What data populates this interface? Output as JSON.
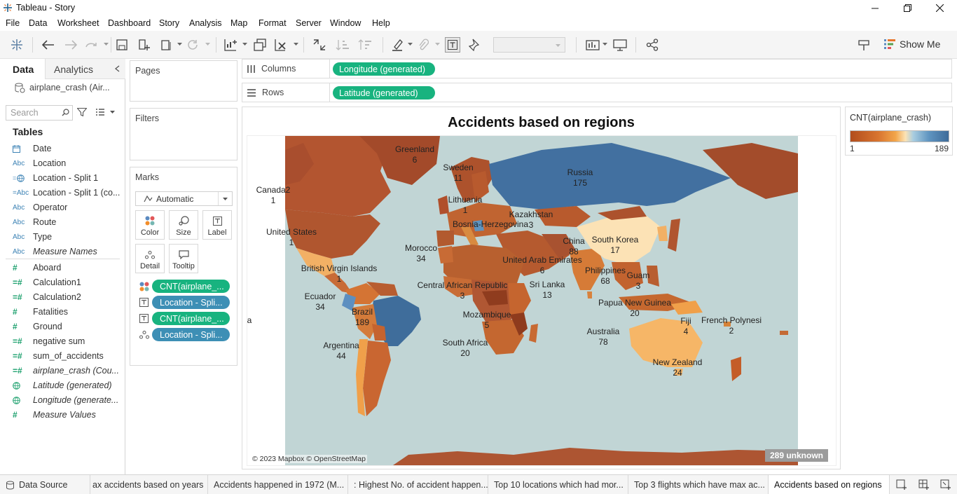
{
  "window": {
    "title": "Tableau - Story"
  },
  "menu": [
    "File",
    "Data",
    "Worksheet",
    "Dashboard",
    "Story",
    "Analysis",
    "Map",
    "Format",
    "Server",
    "Window",
    "Help"
  ],
  "toolbar": {
    "show_me": "Show Me"
  },
  "data_pane": {
    "tab_data": "Data",
    "tab_analytics": "Analytics",
    "datasource": "airplane_crash (Air...",
    "search_placeholder": "Search",
    "tables_header": "Tables",
    "fields": [
      {
        "icon": "calendar",
        "label": "Date",
        "italic": false
      },
      {
        "icon": "Abc",
        "label": "Location",
        "italic": false
      },
      {
        "icon": "globe",
        "label": "Location - Split 1",
        "italic": false
      },
      {
        "icon": "=Abc",
        "label": "Location - Split 1 (co...",
        "italic": false
      },
      {
        "icon": "Abc",
        "label": "Operator",
        "italic": false
      },
      {
        "icon": "Abc",
        "label": "Route",
        "italic": false
      },
      {
        "icon": "Abc",
        "label": "Type",
        "italic": false
      },
      {
        "icon": "Abc",
        "label": "Measure Names",
        "italic": true
      },
      {
        "icon": "#",
        "label": "Aboard",
        "italic": false
      },
      {
        "icon": "=#",
        "label": "Calculation1",
        "italic": false
      },
      {
        "icon": "=#",
        "label": "Calculation2",
        "italic": false
      },
      {
        "icon": "#",
        "label": "Fatalities",
        "italic": false
      },
      {
        "icon": "#",
        "label": "Ground",
        "italic": false
      },
      {
        "icon": "=#",
        "label": "negative sum",
        "italic": false
      },
      {
        "icon": "=#",
        "label": "sum_of_accidents",
        "italic": false
      },
      {
        "icon": "=#",
        "label": "airplane_crash (Cou...",
        "italic": true
      },
      {
        "icon": "globe",
        "label": "Latitude (generated)",
        "italic": true
      },
      {
        "icon": "globe",
        "label": "Longitude (generate...",
        "italic": true
      },
      {
        "icon": "#",
        "label": "Measure Values",
        "italic": true
      }
    ]
  },
  "pages_card": {
    "title": "Pages"
  },
  "filters_card": {
    "title": "Filters"
  },
  "marks_card": {
    "title": "Marks",
    "mark_type": "Automatic",
    "buttons": {
      "color": "Color",
      "size": "Size",
      "label": "Label",
      "detail": "Detail",
      "tooltip": "Tooltip"
    },
    "pills": [
      "CNT(airplane_...",
      "Location - Spli...",
      "CNT(airplane_...",
      "Location - Spli..."
    ]
  },
  "shelves": {
    "columns_label": "Columns",
    "columns_pill": "Longitude (generated)",
    "rows_label": "Rows",
    "rows_pill": "Latitude (generated)"
  },
  "viz": {
    "title": "Accidents based on regions",
    "attribution": "© 2023 Mapbox © OpenStreetMap",
    "unknown_badge": "289 unknown",
    "labels": [
      {
        "name": "Greenland",
        "value": "6"
      },
      {
        "name": "Sweden",
        "value": "11"
      },
      {
        "name": "Russia",
        "value": "175"
      },
      {
        "name": "Canada2",
        "value": "1"
      },
      {
        "name": "Lithuania",
        "value": "1"
      },
      {
        "name": "Kazakhstan",
        "value": "3"
      },
      {
        "name": "Bosnia-Herzegovina",
        "value": ""
      },
      {
        "name": "United States",
        "value": "1"
      },
      {
        "name": "China",
        "value": "88"
      },
      {
        "name": "South Korea",
        "value": "17"
      },
      {
        "name": "Morocco",
        "value": "34"
      },
      {
        "name": "United Arab Emirates",
        "value": "6"
      },
      {
        "name": "British Virgin Islands",
        "value": "1"
      },
      {
        "name": "Philippines",
        "value": "68"
      },
      {
        "name": "Guam",
        "value": "3"
      },
      {
        "name": "Central African Republic",
        "value": "3"
      },
      {
        "name": "Sri Lanka",
        "value": "13"
      },
      {
        "name": "Ecuador",
        "value": "34"
      },
      {
        "name": "Papua New Guinea",
        "value": "20"
      },
      {
        "name": "Brazil",
        "value": "189"
      },
      {
        "name": "Mozambique",
        "value": "5"
      },
      {
        "name": "Fiji",
        "value": "4"
      },
      {
        "name": "French Polynesi",
        "value": "2"
      },
      {
        "name": "Australia",
        "value": "78"
      },
      {
        "name": "Argentina",
        "value": "44"
      },
      {
        "name": "South Africa",
        "value": "20"
      },
      {
        "name": "New Zealand",
        "value": "24"
      },
      {
        "name": "a",
        "value": ""
      }
    ]
  },
  "legend": {
    "title": "CNT(airplane_crash)",
    "min": "1",
    "max": "189",
    "colors": [
      "#b24d1d",
      "#d8742f",
      "#f2a54a",
      "#fce3b5",
      "#a9cde0",
      "#5f94c0",
      "#3e6b99"
    ]
  },
  "bottom_tabs": {
    "data_source": "Data Source",
    "stories": [
      "ax accidents based on years",
      "Accidents happened in 1972 (M...",
      ": Highest No. of accident happen...",
      "Top 10 locations which had mor...",
      "Top 3 flights which have max ac...",
      "Accidents based on regions"
    ]
  },
  "colors": {
    "green_pill": "#18b37f",
    "blue_pill": "#3d8fb5",
    "ocean": "#c1d5d5"
  }
}
